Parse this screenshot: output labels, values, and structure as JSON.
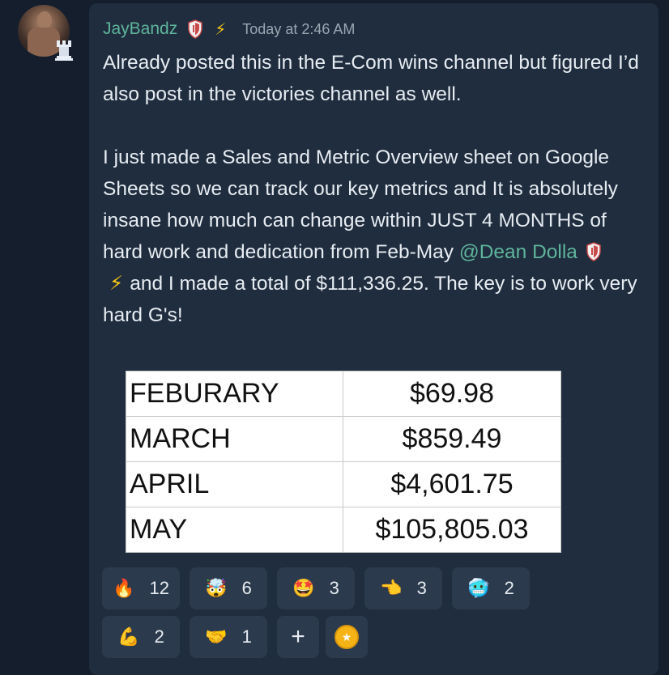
{
  "post": {
    "username": "JayBandz",
    "timestamp": "Today at 2:46 AM",
    "paragraph1": "Already posted this in the E-Com wins channel but figured I’d also post in the victories channel as well.",
    "paragraph2_start": "I just made a Sales and Metric Overview sheet on Google Sheets so we can track our key metrics and It is absolutely insane how much can change within JUST 4 MONTHS of hard work and dedication from Feb-May ",
    "mention": "@Dean Dolla",
    "paragraph2_end": "and I made a total of $111,336.25. The key is to work very hard G's!"
  },
  "sheet": {
    "rows": [
      {
        "month": "FEBURARY",
        "amount": "$69.98"
      },
      {
        "month": "MARCH",
        "amount": "$859.49"
      },
      {
        "month": "APRIL",
        "amount": "$4,601.75"
      },
      {
        "month": "MAY",
        "amount": "$105,805.03"
      }
    ]
  },
  "reactions": {
    "row1": [
      {
        "icon": "fire-icon",
        "emoji": "🔥",
        "count": "12"
      },
      {
        "icon": "exploding-head-icon",
        "emoji": "🤯",
        "count": "6"
      },
      {
        "icon": "star-struck-icon",
        "emoji": "🤩",
        "count": "3"
      },
      {
        "icon": "saluting-hand-icon",
        "emoji": "👈",
        "count": "3"
      },
      {
        "icon": "cold-face-icon",
        "emoji": "🥶",
        "count": "2"
      }
    ],
    "row2": [
      {
        "icon": "flexed-biceps-icon",
        "emoji": "💪",
        "count": "2"
      },
      {
        "icon": "handshake-icon",
        "emoji": "🤝",
        "count": "1"
      }
    ],
    "add_icon": "plus-icon",
    "coin_icon": "coin-icon"
  },
  "colors": {
    "background": "#141e2c",
    "bubble": "#1f2d3e",
    "username": "#5fb59c",
    "mention": "#5fb59c",
    "bolt": "#f5c518",
    "timestamp": "#9aa6b2",
    "text": "#e7ecf2",
    "reaction_bg": "#2b3a4c"
  }
}
